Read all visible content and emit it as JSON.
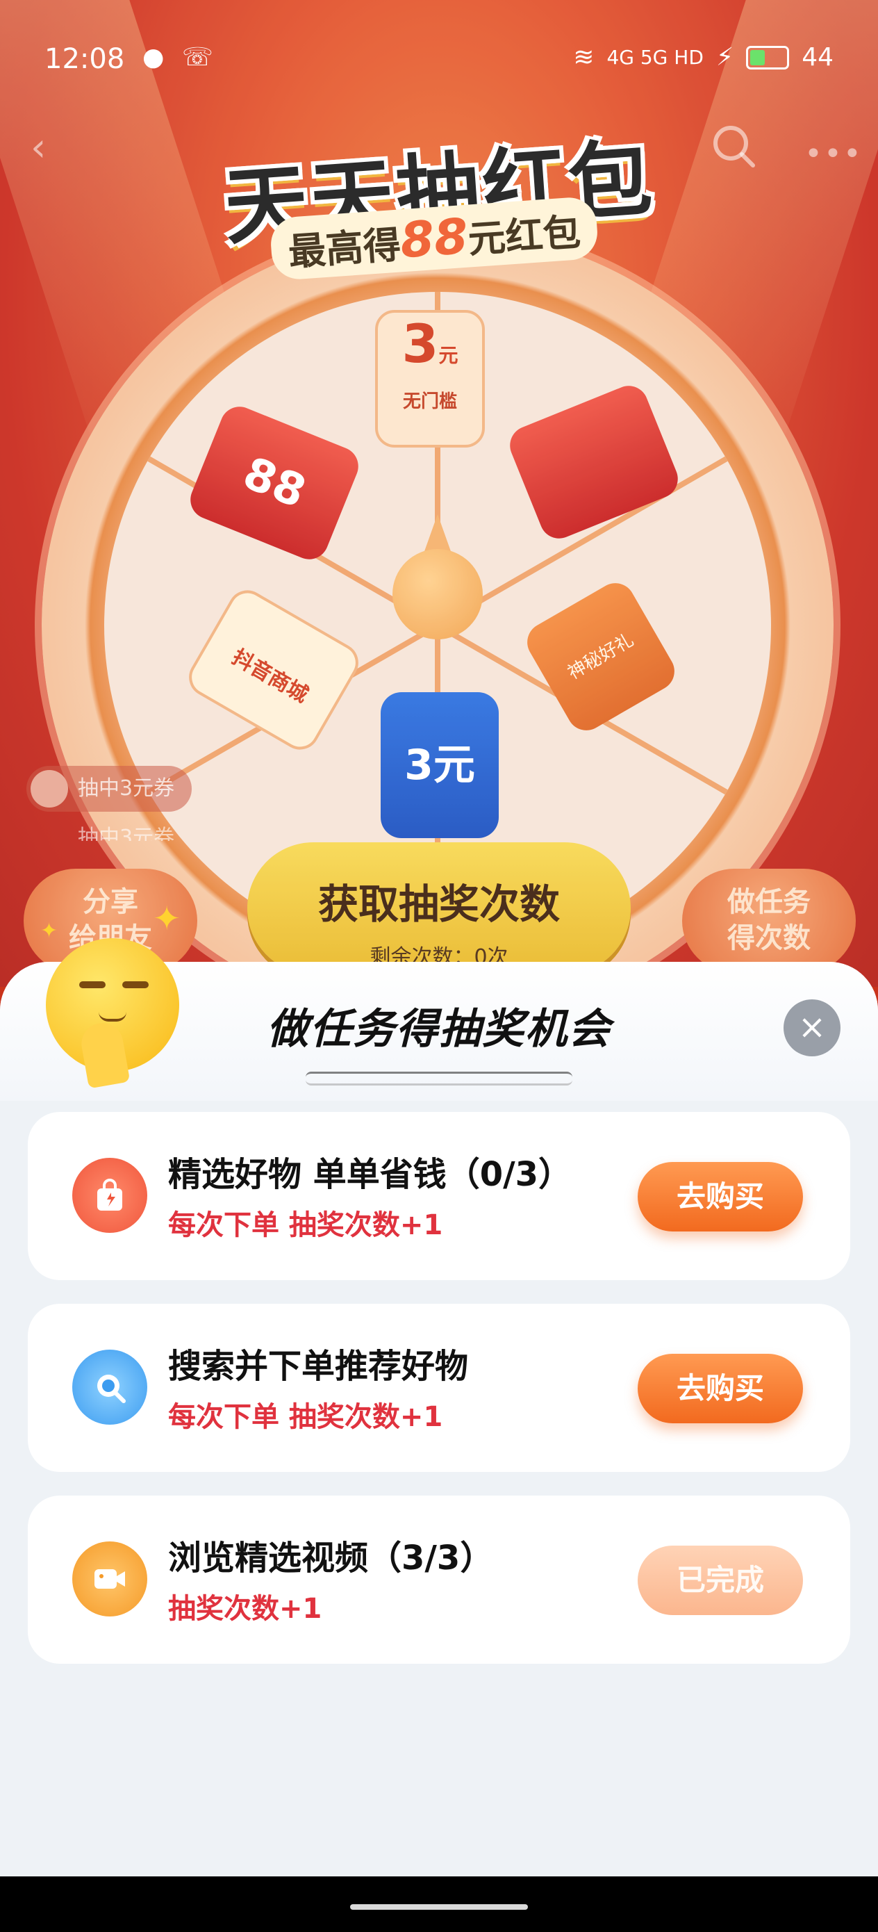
{
  "status_bar": {
    "time": "12:08",
    "network_label": "4G 5G HD",
    "battery": "44"
  },
  "hero": {
    "title": "天天抽红包",
    "subtitle_prefix": "最高得",
    "subtitle_amount": "88",
    "subtitle_suffix": "元红包"
  },
  "wheel": {
    "coupon_amount": "3",
    "coupon_unit": "元",
    "coupon_label": "无门槛",
    "red_packet_amount": "88",
    "gift_label": "神秘好礼",
    "shop_label": "抖音商城",
    "blue_label": "3元"
  },
  "ticker": {
    "line1": "抽中3元券",
    "line2": "抽中3元券"
  },
  "actions": {
    "share_label_1": "分享",
    "share_label_2": "给朋友",
    "draw_label": "获取抽奖次数",
    "remaining": "剩余次数：0次",
    "task_label_1": "做任务",
    "task_label_2": "得次数"
  },
  "sheet": {
    "title": "做任务得抽奖机会",
    "tasks": [
      {
        "title": "精选好物 单单省钱（0/3）",
        "subtitle": "每次下单 抽奖次数+1",
        "button": "去购买",
        "icon": "shopping-bag-icon",
        "done": false
      },
      {
        "title": "搜索并下单推荐好物",
        "subtitle": "每次下单 抽奖次数+1",
        "button": "去购买",
        "icon": "search-icon",
        "done": false
      },
      {
        "title": "浏览精选视频（3/3）",
        "subtitle": "抽奖次数+1",
        "button": "已完成",
        "icon": "video-camera-icon",
        "done": true
      }
    ]
  },
  "colors": {
    "accent_orange": "#f26a1f",
    "red_text": "#e0323e",
    "sheet_bg": "#eef2f6"
  }
}
